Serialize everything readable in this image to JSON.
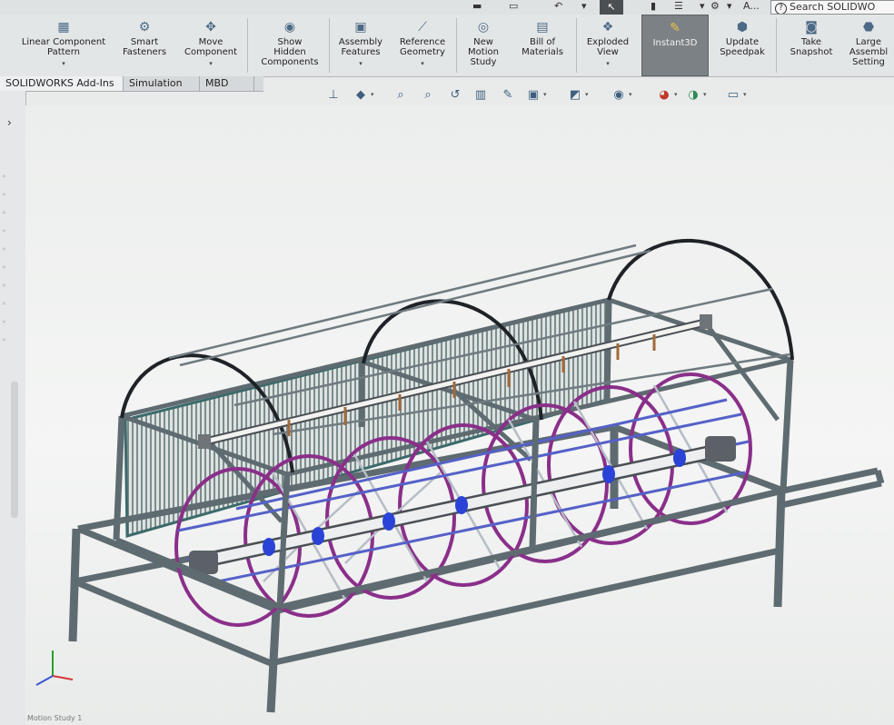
{
  "quick_access": {
    "search_label": "Search SOLIDWO",
    "extra_label": "A..."
  },
  "ribbon": {
    "buttons": [
      {
        "label": "Linear Component\nPattern",
        "icon": "linear-pattern-icon"
      },
      {
        "label": "Smart\nFasteners",
        "icon": "smart-fasteners-icon"
      },
      {
        "label": "Move\nComponent",
        "icon": "move-component-icon"
      },
      {
        "label": "Show\nHidden\nComponents",
        "icon": "show-hidden-icon"
      },
      {
        "label": "Assembly\nFeatures",
        "icon": "assembly-features-icon"
      },
      {
        "label": "Reference\nGeometry",
        "icon": "reference-geometry-icon"
      },
      {
        "label": "New\nMotion\nStudy",
        "icon": "motion-study-icon"
      },
      {
        "label": "Bill of\nMaterials",
        "icon": "bom-icon"
      },
      {
        "label": "Exploded\nView",
        "icon": "exploded-view-icon"
      },
      {
        "label": "Instant3D",
        "icon": "instant3d-icon"
      },
      {
        "label": "Update\nSpeedpak",
        "icon": "speedpak-icon"
      },
      {
        "label": "Take\nSnapshot",
        "icon": "snapshot-icon"
      },
      {
        "label": "Large\nAssembl\nSetting",
        "icon": "large-assembly-icon"
      }
    ]
  },
  "tabs": [
    {
      "label": "SOLIDWORKS Add-Ins"
    },
    {
      "label": "Simulation"
    },
    {
      "label": "MBD"
    }
  ],
  "status_text": "Motion Study 1",
  "colors": {
    "frame": "#5e6b70",
    "hoops": "#1f2327",
    "screen": "#3c6a6a",
    "wheels": "#8a2f8a",
    "rods": "#5561c8",
    "hubs": "#2a43d6"
  }
}
